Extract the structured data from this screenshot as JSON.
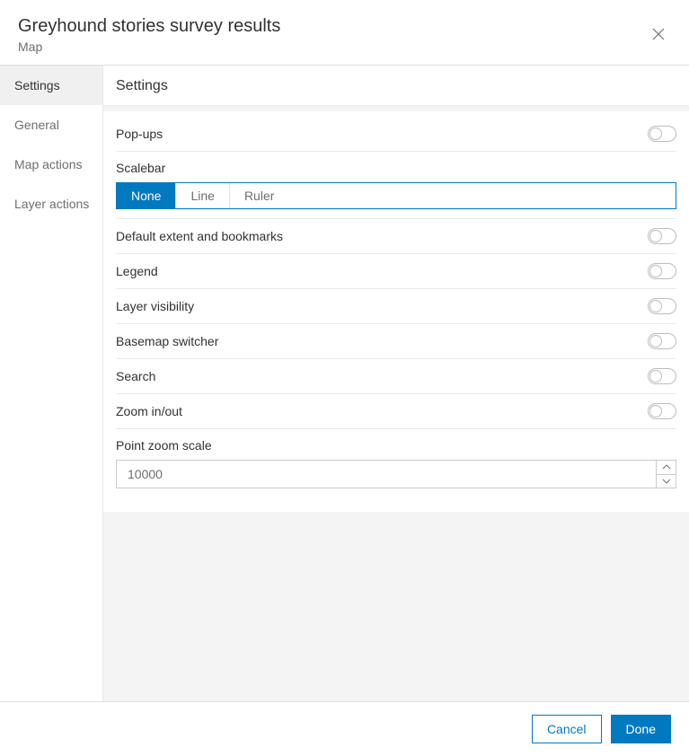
{
  "header": {
    "title": "Greyhound stories survey results",
    "subtitle": "Map"
  },
  "sidebar": {
    "items": [
      {
        "label": "Settings",
        "active": true
      },
      {
        "label": "General",
        "active": false
      },
      {
        "label": "Map actions",
        "active": false
      },
      {
        "label": "Layer actions",
        "active": false
      }
    ]
  },
  "main": {
    "title": "Settings",
    "popups_label": "Pop-ups",
    "scalebar_label": "Scalebar",
    "scalebar_options": [
      "None",
      "Line",
      "Ruler"
    ],
    "scalebar_selected": "None",
    "default_extent_label": "Default extent and bookmarks",
    "legend_label": "Legend",
    "layer_visibility_label": "Layer visibility",
    "basemap_switcher_label": "Basemap switcher",
    "search_label": "Search",
    "zoom_label": "Zoom in/out",
    "point_zoom_label": "Point zoom scale",
    "point_zoom_value": "10000"
  },
  "footer": {
    "cancel": "Cancel",
    "done": "Done"
  },
  "toggles": {
    "popups": false,
    "default_extent": false,
    "legend": false,
    "layer_visibility": false,
    "basemap_switcher": false,
    "search": false,
    "zoom": false
  }
}
